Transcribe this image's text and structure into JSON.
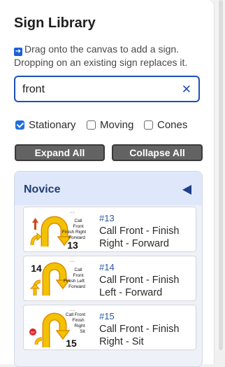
{
  "panel": {
    "title": "Sign Library",
    "hint_icon": "arrow-right-icon",
    "hint": "Drag onto the canvas to add a sign. Dropping on an existing sign replaces it."
  },
  "search": {
    "value": "front",
    "placeholder": "",
    "clear_glyph": "✕"
  },
  "filters": [
    {
      "label": "Stationary",
      "checked": true
    },
    {
      "label": "Moving",
      "checked": false
    },
    {
      "label": "Cones",
      "checked": false
    }
  ],
  "buttons": {
    "expand_all": "Expand All",
    "collapse_all": "Collapse All"
  },
  "group": {
    "title": "Novice",
    "state_icon": "triangle-left-icon",
    "signs": [
      {
        "number": "#13",
        "name": "Call Front - Finish Right - Forward",
        "thumb_number": "13",
        "thumb_lines": [
          "Call",
          "Front",
          "Finish Right",
          "Forward"
        ]
      },
      {
        "number": "#14",
        "name": "Call Front - Finish Left - Forward",
        "thumb_number": "14",
        "thumb_lines": [
          "Call",
          "Front",
          "Finish Left",
          "Forward"
        ]
      },
      {
        "number": "#15",
        "name": "Call Front - Finish Right - Sit",
        "thumb_number": "15",
        "thumb_lines": [
          "Call Front",
          "Finish",
          "Right",
          "Sit"
        ]
      }
    ]
  },
  "colors": {
    "accent": "#1e4fb8",
    "checkbox": "#1f6fde",
    "group_header": "#dfe7fb",
    "sign_arrow": "#f2c200",
    "sign_outline": "#e08a00",
    "sit_badge": "#d8262b"
  }
}
